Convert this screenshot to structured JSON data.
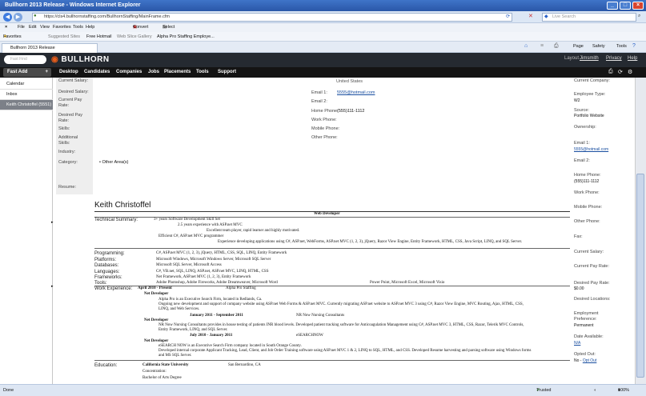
{
  "window": {
    "title": "Bullhorn 2013 Release - Windows Internet Explorer"
  },
  "browser": {
    "url": "https://cls4.bullhornstaffing.com/BullhornStaffing/MainFrame.cfm",
    "search_placeholder": "Live Search",
    "menu": [
      "File",
      "Edit",
      "View",
      "Favorites",
      "Tools",
      "Help"
    ],
    "convert_label": "Convert",
    "select_label": "Select",
    "favorites": {
      "label": "Favorites",
      "items": [
        "Suggested Sites",
        "Free Hotmail",
        "Web Slice Gallery",
        "Alpha Pro Staffing Employe..."
      ]
    },
    "tab": "Bullhorn 2013 Release",
    "commands": [
      "Page",
      "Safety",
      "Tools"
    ]
  },
  "app": {
    "fast_find_placeholder": "Fast Find",
    "logo": "BULLHORN",
    "top_links": [
      "Layout",
      "Jimsmith",
      "Privacy",
      "Help"
    ],
    "fast_add": "Fast Add",
    "nav": [
      "Desktop",
      "Candidates",
      "Companies",
      "Jobs",
      "Placements",
      "Tools",
      "Support"
    ]
  },
  "sidebar": {
    "items": [
      "Calendar",
      "Inbox",
      "Keith Christoffel (5551)"
    ]
  },
  "left_fields": {
    "labels": [
      "Current Salary:",
      "Desired Salary:",
      "Current Pay Rate:",
      "Desired Pay Rate:",
      "Skills:",
      "Additional Skills:",
      "Industry:",
      "Category:",
      "Resume:"
    ],
    "category_value": "Other Area(s)"
  },
  "center_fields": {
    "address_line": "United States",
    "labels": [
      "Email 1:",
      "Email 2:",
      "Home Phone:",
      "Work Phone:",
      "Mobile Phone:",
      "Other Phone:"
    ],
    "email1": "5555@hotmail.com",
    "home_phone": "(555)111-1112"
  },
  "right_fields": {
    "current_company_label": "Current Company:",
    "employee_type_label": "Employee Type:",
    "employee_type": "W2",
    "source_label": "Source:",
    "source": "Portfolio Website",
    "ownership_label": "Ownership:",
    "email1_label": "Email 1:",
    "email1": "5555@hotmail.com",
    "email2_label": "Email 2:",
    "home_phone_label": "Home Phone:",
    "home_phone": "(555)111-1112",
    "work_phone_label": "Work Phone:",
    "mobile_phone_label": "Mobile Phone:",
    "other_phone_label": "Other Phone:",
    "fax_label": "Fax:",
    "current_salary_label": "Current Salary:",
    "current_pay_label": "Current Pay Rate:",
    "desired_pay_label": "Desired Pay Rate:",
    "desired_pay": "$0.00",
    "desired_locations_label": "Desired Locations:",
    "employment_pref_label": "Employment Preference:",
    "employment_pref": "Permanent",
    "date_available_label": "Date Available:",
    "date_available": "N/A",
    "opted_out_label": "Opted Out:",
    "opted_out": "No -",
    "opt_out_link": "Opt Out"
  },
  "resume": {
    "name": "Keith Christoffel",
    "title": "Web Developer",
    "summary_label": "Technical Summary:",
    "summary": [
      "3+ years Software Development Skill Set",
      "2.5 years experience with ASP.net MVC",
      "Excellent team player, rapid learner and highly motivated.",
      "Efficient C#, ASP.net MVC programmer",
      "Experience developing applications using C#, ASP.net, WebForms, ASP.net MVC (1, 2, 3), jQuery, Razor View Engine, Entity Framework, HTML, CSS, Java Script, LINQ, and SQL Server."
    ],
    "skill_labels": [
      "Programming:",
      "Platforms:",
      "Databases:",
      "Languages:",
      "Frameworks:",
      "Tools:"
    ],
    "skill_values": [
      "C#, ASP.net MVC (1, 2, 3), jQuery, HTML, CSS, SQL, LINQ, Entity Framework",
      "Microsoft Windows, Microsoft Windows Server, Microsoft SQL Server",
      "Microsoft SQL Server, Microsoft Access",
      "C#, VB.net, SQL, LINQ, ASP.net, ASP.net MVC, LINQ, HTML, CSS",
      "Net Framework, ASP.net MVC (1, 2, 3), Entity Framework",
      "Adobe Photoshop, Adobe Fireworks, Adobe Dreamweaver, Microsoft Word",
      "Power Point, Microsoft Excel, Microsoft Visio"
    ],
    "experience_label": "Work Experience:",
    "jobs": [
      {
        "dates": "April 2010 - Present",
        "company": "Alpha Pro Staffing",
        "role": "Net Developer",
        "lines": [
          "Alpha Pro is an Executive Search Firm, located in Redlands, Ca.",
          "Ongoing new development and support of company website using ASP.net Web Forms & ASP.net MVC. Currently migrating ASP.net website to ASP.net MVC 3 using C#, Razor View Engine, MVC Routing, Ajax, HTML, CSS,",
          "LINQ, and Web Services."
        ]
      },
      {
        "dates": "January 2011 - September 2011",
        "company": "NR Now Nursing Consultants",
        "role": "Net Developer",
        "lines": [
          "NR Now Nursing Consultants provides in house testing of patients INR blood levels. Developed patient tracking software for Anticoagulation Management using C#, ASP.net MVC 3, HTML, CSS, Razor, Telerik MVC Controls,",
          "Entity Framework, LINQ, and SQL Server."
        ]
      },
      {
        "dates": "July 2010 - January 2011",
        "company": "eSEARCHNOW",
        "role": "Net Developer",
        "lines": [
          "eSEARCH NOW is an Executive Search Firm company located in South Orange County.",
          "Developed internal corporate Applicant Tracking, Lead, Client, and Job Order Training software using ASP.net MVC 1 & 2, LINQ to SQL, HTML, and CSS. Developed Resume harvesting and parsing software using Windows forms",
          "and MS SQL Server."
        ]
      }
    ],
    "education_label": "Education:",
    "education": {
      "school": "California State University",
      "location": "San Bernardino, CA",
      "concentration": "Concentration:",
      "degree": "Bachelor of Arts Degree"
    }
  },
  "status": {
    "left": "Done",
    "zone": "Trusted sites",
    "zoom": "100%"
  },
  "colors": {
    "titlebar": "#2a57a8",
    "app_header": "#252a31",
    "nav": "#141414",
    "link": "#1a4fa0"
  }
}
